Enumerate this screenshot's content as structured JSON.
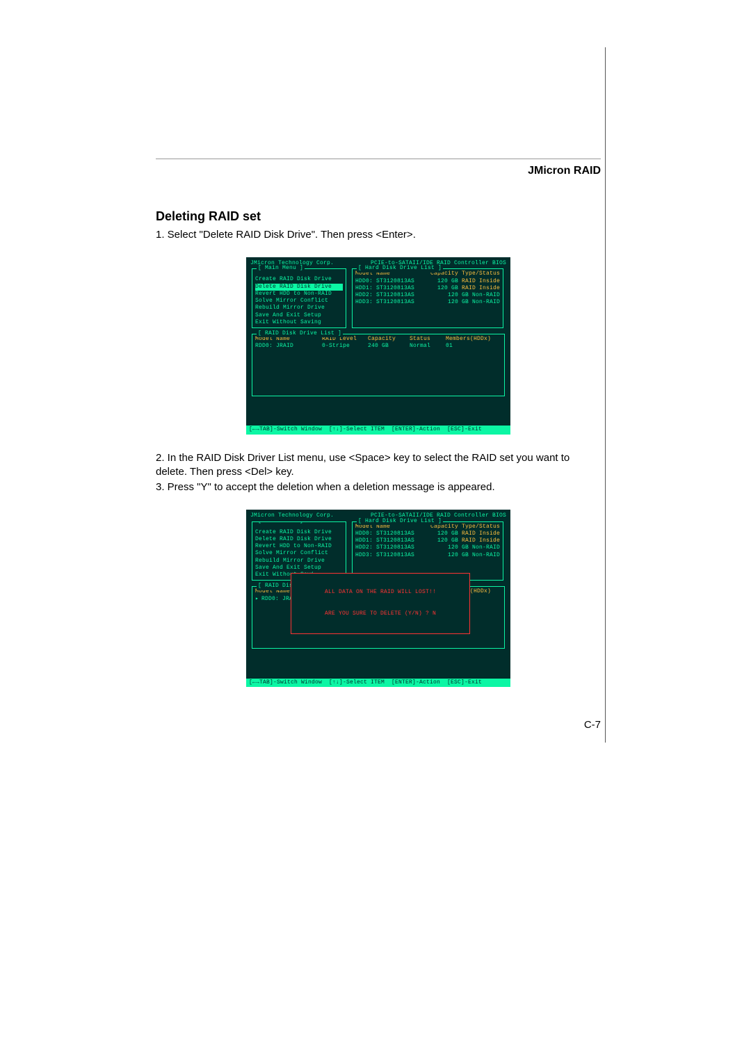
{
  "header": "JMicron RAID",
  "section_title": "Deleting RAID set",
  "step1": "1. Select \"Delete RAID Disk Drive\". Then press <Enter>.",
  "step2": "2. In the RAID Disk Driver List menu, use <Space> key to select the RAID set you want to delete. Then press <Del> key.",
  "step3": "3. Press \"Y\" to accept the deletion when a deletion message is appeared.",
  "page_number": "C-7",
  "bios_common": {
    "top_left": "JMicron Technology Corp.",
    "top_right": "PCIE-to-SATAII/IDE RAID Controller BIOS",
    "main_menu_title": "[ Main Menu ]",
    "hdd_list_title": "[ Hard Disk Drive List ]",
    "raid_list_title": "[ RAID Disk Drive List ]",
    "menu_items": [
      "Create RAID Disk Drive",
      "Delete RAID Disk Drive",
      "Revert HDD to Non-RAID",
      "Solve Mirror Conflict",
      "Rebuild Mirror Drive",
      "Save And Exit Setup",
      "Exit Without Saving"
    ],
    "hdd_headers": {
      "c1": "Model Name",
      "c2": "Capacity",
      "c3": "Type/Status"
    },
    "hdds": [
      {
        "name": "HDD0: ST3120813AS",
        "cap": "120 GB",
        "type": "RAID Inside"
      },
      {
        "name": "HDD1: ST3120813AS",
        "cap": "120 GB",
        "type": "RAID Inside"
      },
      {
        "name": "HDD2: ST3120813AS",
        "cap": "120 GB",
        "type": "Non-RAID"
      },
      {
        "name": "HDD3: ST3120813AS",
        "cap": "120 GB",
        "type": "Non-RAID"
      }
    ],
    "raid_headers": {
      "c1": "Model Name",
      "c2": "RAID Level",
      "c3": "Capacity",
      "c4": "Status",
      "c5": "Members(HDDx)"
    },
    "raid_rows": [
      {
        "c1": "RDD0: JRAID",
        "c2": "0-Stripe",
        "c3": "240 GB",
        "c4": "Normal",
        "c5": "01"
      }
    ],
    "footer": "[←→TAB]-Switch Window  [↑↓]-Select ITEM  [ENTER]-Action  [ESC]-Exit"
  },
  "bios1": {
    "highlight_index": 1
  },
  "bios2": {
    "highlight_index": null,
    "menu_last_truncated": "Exit Without Savi",
    "raid_title_truncated": "[ RAID Disk Driv",
    "delete_msg_line1": "ALL DATA ON THE RAID WILL LOST!!",
    "delete_msg_line2": "ARE YOU SURE TO DELETE (Y/N) ? N"
  }
}
